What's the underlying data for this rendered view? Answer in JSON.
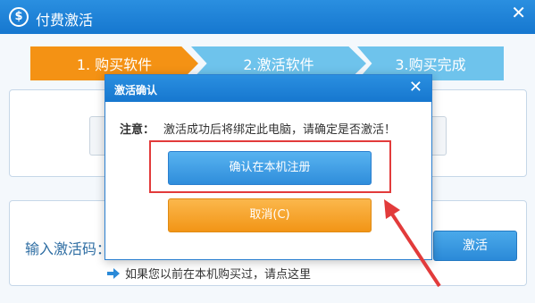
{
  "window": {
    "title": "付费激活",
    "icon": "dollar-circle-icon",
    "close_glyph": "✕"
  },
  "steps": [
    {
      "label": "1. 购买软件",
      "active": true
    },
    {
      "label": "2.激活软件",
      "active": false
    },
    {
      "label": "3.购买完成",
      "active": false
    }
  ],
  "activation": {
    "code_label": "输入激活码：",
    "activate_button": "激活",
    "purchased_link": "如果您以前在本机购买过，请点这里"
  },
  "dialog": {
    "title": "激活确认",
    "close_glyph": "✕",
    "note_label": "注意：",
    "message": "激活成功后将绑定此电脑，请确定是否激活！",
    "confirm_button": "确认在本机注册",
    "cancel_button": "取消(C)"
  },
  "colors": {
    "title_bar": "#1e84d8",
    "active_step": "#f49214",
    "inactive_step": "#6ec3ec",
    "confirm_button": "#3896df",
    "cancel_button": "#f5a123",
    "annotation": "#e23b3b"
  }
}
